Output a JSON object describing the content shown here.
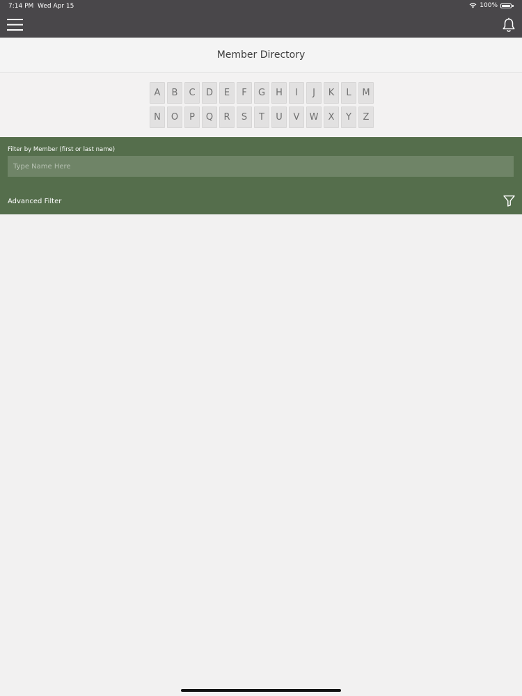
{
  "status_bar": {
    "time": "7:14 PM",
    "date": "Wed Apr 15",
    "battery": "100%"
  },
  "header": {
    "title": "Member Directory"
  },
  "alphabet": {
    "row1": [
      "A",
      "B",
      "C",
      "D",
      "E",
      "F",
      "G",
      "H",
      "I",
      "J",
      "K",
      "L",
      "M"
    ],
    "row2": [
      "N",
      "O",
      "P",
      "Q",
      "R",
      "S",
      "T",
      "U",
      "V",
      "W",
      "X",
      "Y",
      "Z"
    ]
  },
  "filter": {
    "label": "Filter by Member (first or last name)",
    "placeholder": "Type Name Here",
    "value": "",
    "advanced_label": "Advanced Filter"
  },
  "colors": {
    "top_bar": "#49474a",
    "filter_bg": "#556e4c",
    "input_bg": "#6f8467",
    "page_bg": "#f2f1f1"
  },
  "icons": {
    "menu": "hamburger-menu-icon",
    "notifications": "bell-icon",
    "filter": "funnel-filter-icon",
    "wifi": "wifi-icon",
    "battery": "battery-icon"
  }
}
